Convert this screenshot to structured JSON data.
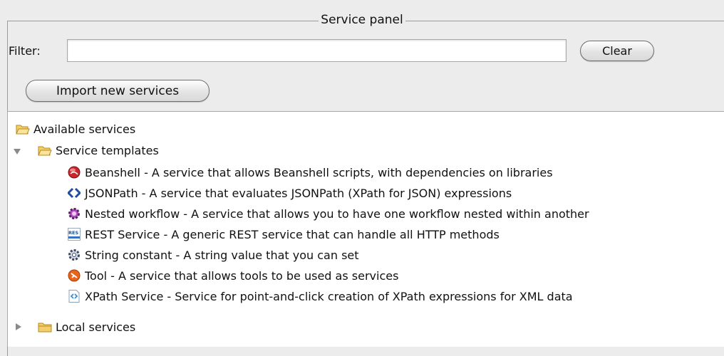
{
  "panel": {
    "title": "Service panel"
  },
  "filter": {
    "label": "Filter:",
    "value": "",
    "placeholder": "",
    "clear_label": "Clear"
  },
  "import_label": "Import new services",
  "tree": {
    "root": "Available services",
    "templates": {
      "label": "Service templates",
      "expanded": true,
      "items": [
        {
          "label": "Beanshell - A service that allows Beanshell scripts, with dependencies on libraries",
          "icon": "beanshell-icon"
        },
        {
          "label": "JSONPath - A service that evaluates JSONPath (XPath for JSON) expressions",
          "icon": "jsonpath-icon"
        },
        {
          "label": "Nested workflow - A service that allows you to have one workflow nested within another",
          "icon": "nested-workflow-icon"
        },
        {
          "label": "REST Service - A generic REST service that can handle all HTTP methods",
          "icon": "rest-icon",
          "icon_text": "RES T"
        },
        {
          "label": "String constant - A string value that you can set",
          "icon": "gear-icon"
        },
        {
          "label": "Tool - A service that allows tools to be used as services",
          "icon": "tool-icon"
        },
        {
          "label": "XPath Service - Service for point-and-click creation of XPath expressions for XML data",
          "icon": "xpath-icon"
        }
      ]
    },
    "local": {
      "label": "Local services",
      "expanded": false
    }
  },
  "colors": {
    "folder": "#f3cf6b",
    "folder_edge": "#b98a1e",
    "beanshell": "#c8262c",
    "jsonpath": "#1f4f9c",
    "tool": "#e8631b",
    "xpath": "#3a8fd6"
  }
}
